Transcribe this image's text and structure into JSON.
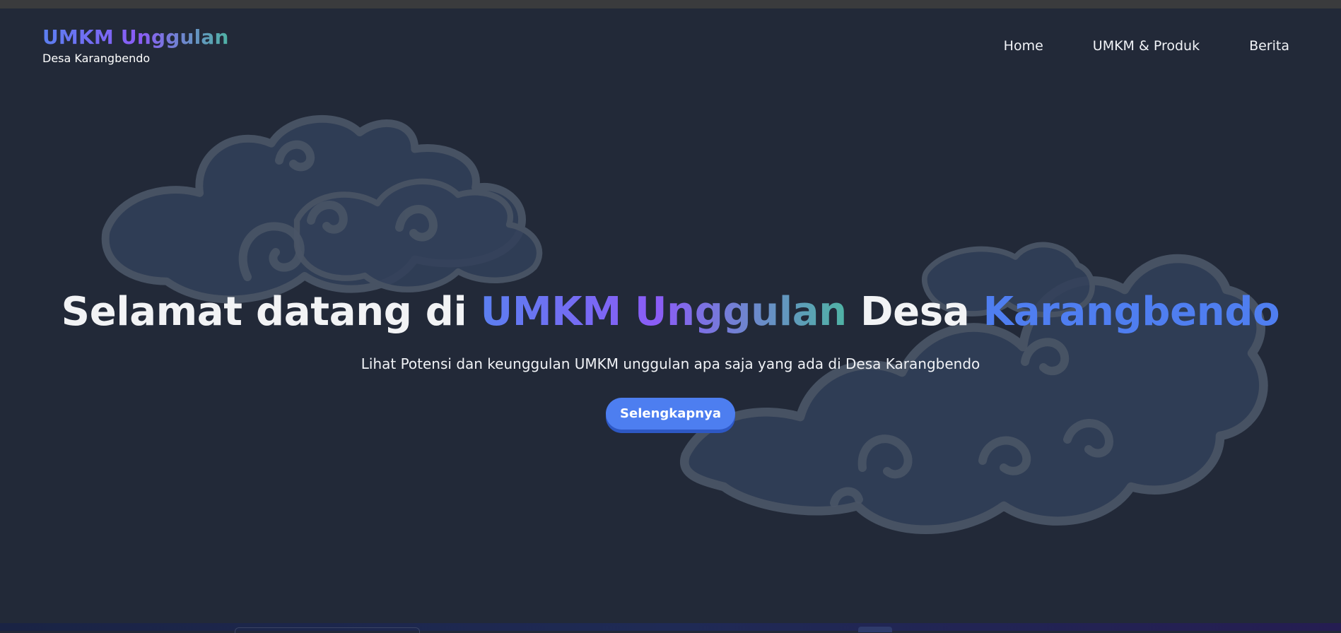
{
  "brand": {
    "title": "UMKM Unggulan",
    "subtitle": "Desa Karangbendo"
  },
  "nav": {
    "items": [
      {
        "label": "Home"
      },
      {
        "label": "UMKM & Produk"
      },
      {
        "label": "Berita"
      }
    ]
  },
  "hero": {
    "title_part1": "Selamat datang di",
    "title_highlight": "UMKM Unggulan",
    "title_part2": "Desa",
    "title_place": "Karangbendo",
    "subtitle": "Lihat Potensi dan keunggulan UMKM unggulan apa saja yang ada di Desa Karangbendo",
    "cta_label": "Selengkapnya"
  },
  "colors": {
    "background": "#222938",
    "accent_blue": "#4d7ef0",
    "gradient_purple": "#8b5cf6",
    "gradient_teal": "#4fb3a4",
    "text": "#f2f3f5"
  },
  "icons": [
    "mega-mendung-cloud-decoration"
  ]
}
